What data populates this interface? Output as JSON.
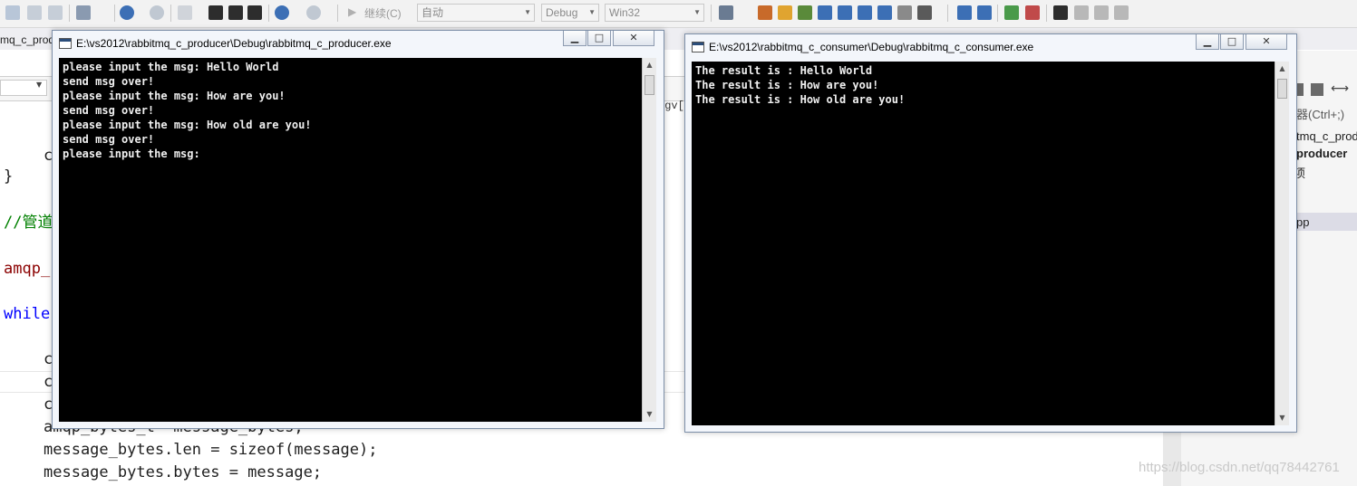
{
  "toolbar": {
    "continue_label": "继续(C)",
    "config_combo": "自动",
    "build_config": "Debug",
    "platform": "Win32"
  },
  "editor": {
    "file_tab": "mq_c_prod",
    "nav_right": "rgv[",
    "code_lines": [
      {
        "text": "c",
        "cls": "id"
      },
      {
        "text": "}",
        "cls": "id"
      },
      {
        "text": "//管道",
        "cls": "cm"
      },
      {
        "text": "amqp_",
        "cls": "fn"
      },
      {
        "text": "while",
        "cls": "kw"
      },
      {
        "text": "c",
        "cls": "id"
      },
      {
        "text": "c",
        "cls": "id"
      },
      {
        "text": "c",
        "cls": "id"
      },
      {
        "text": "amqp_bytes_t  message_bytes;",
        "cls": "id"
      },
      {
        "text": "message_bytes.len = sizeof(message);",
        "cls": "id"
      },
      {
        "text": "message_bytes.bytes = message;",
        "cls": "id"
      }
    ]
  },
  "right_panel": {
    "search_hint": "器(Ctrl+;)",
    "project_line1": "tmq_c_prod",
    "project_line2": "producer",
    "item_small": "项",
    "selected_item": "pp"
  },
  "producer_window": {
    "title": "E:\\vs2012\\rabbitmq_c_producer\\Debug\\rabbitmq_c_producer.exe",
    "lines": [
      "please input the msg: Hello World",
      "send msg over!",
      "please input the msg: How are you!",
      "send msg over!",
      "please input the msg: How old are you!",
      "send msg over!",
      "please input the msg:"
    ]
  },
  "consumer_window": {
    "title": "E:\\vs2012\\rabbitmq_c_consumer\\Debug\\rabbitmq_c_consumer.exe",
    "lines": [
      "The result is : Hello World",
      "The result is : How are you!",
      "The result is : How old are you!"
    ]
  },
  "watermark": "https://blog.csdn.net/qq78442761"
}
